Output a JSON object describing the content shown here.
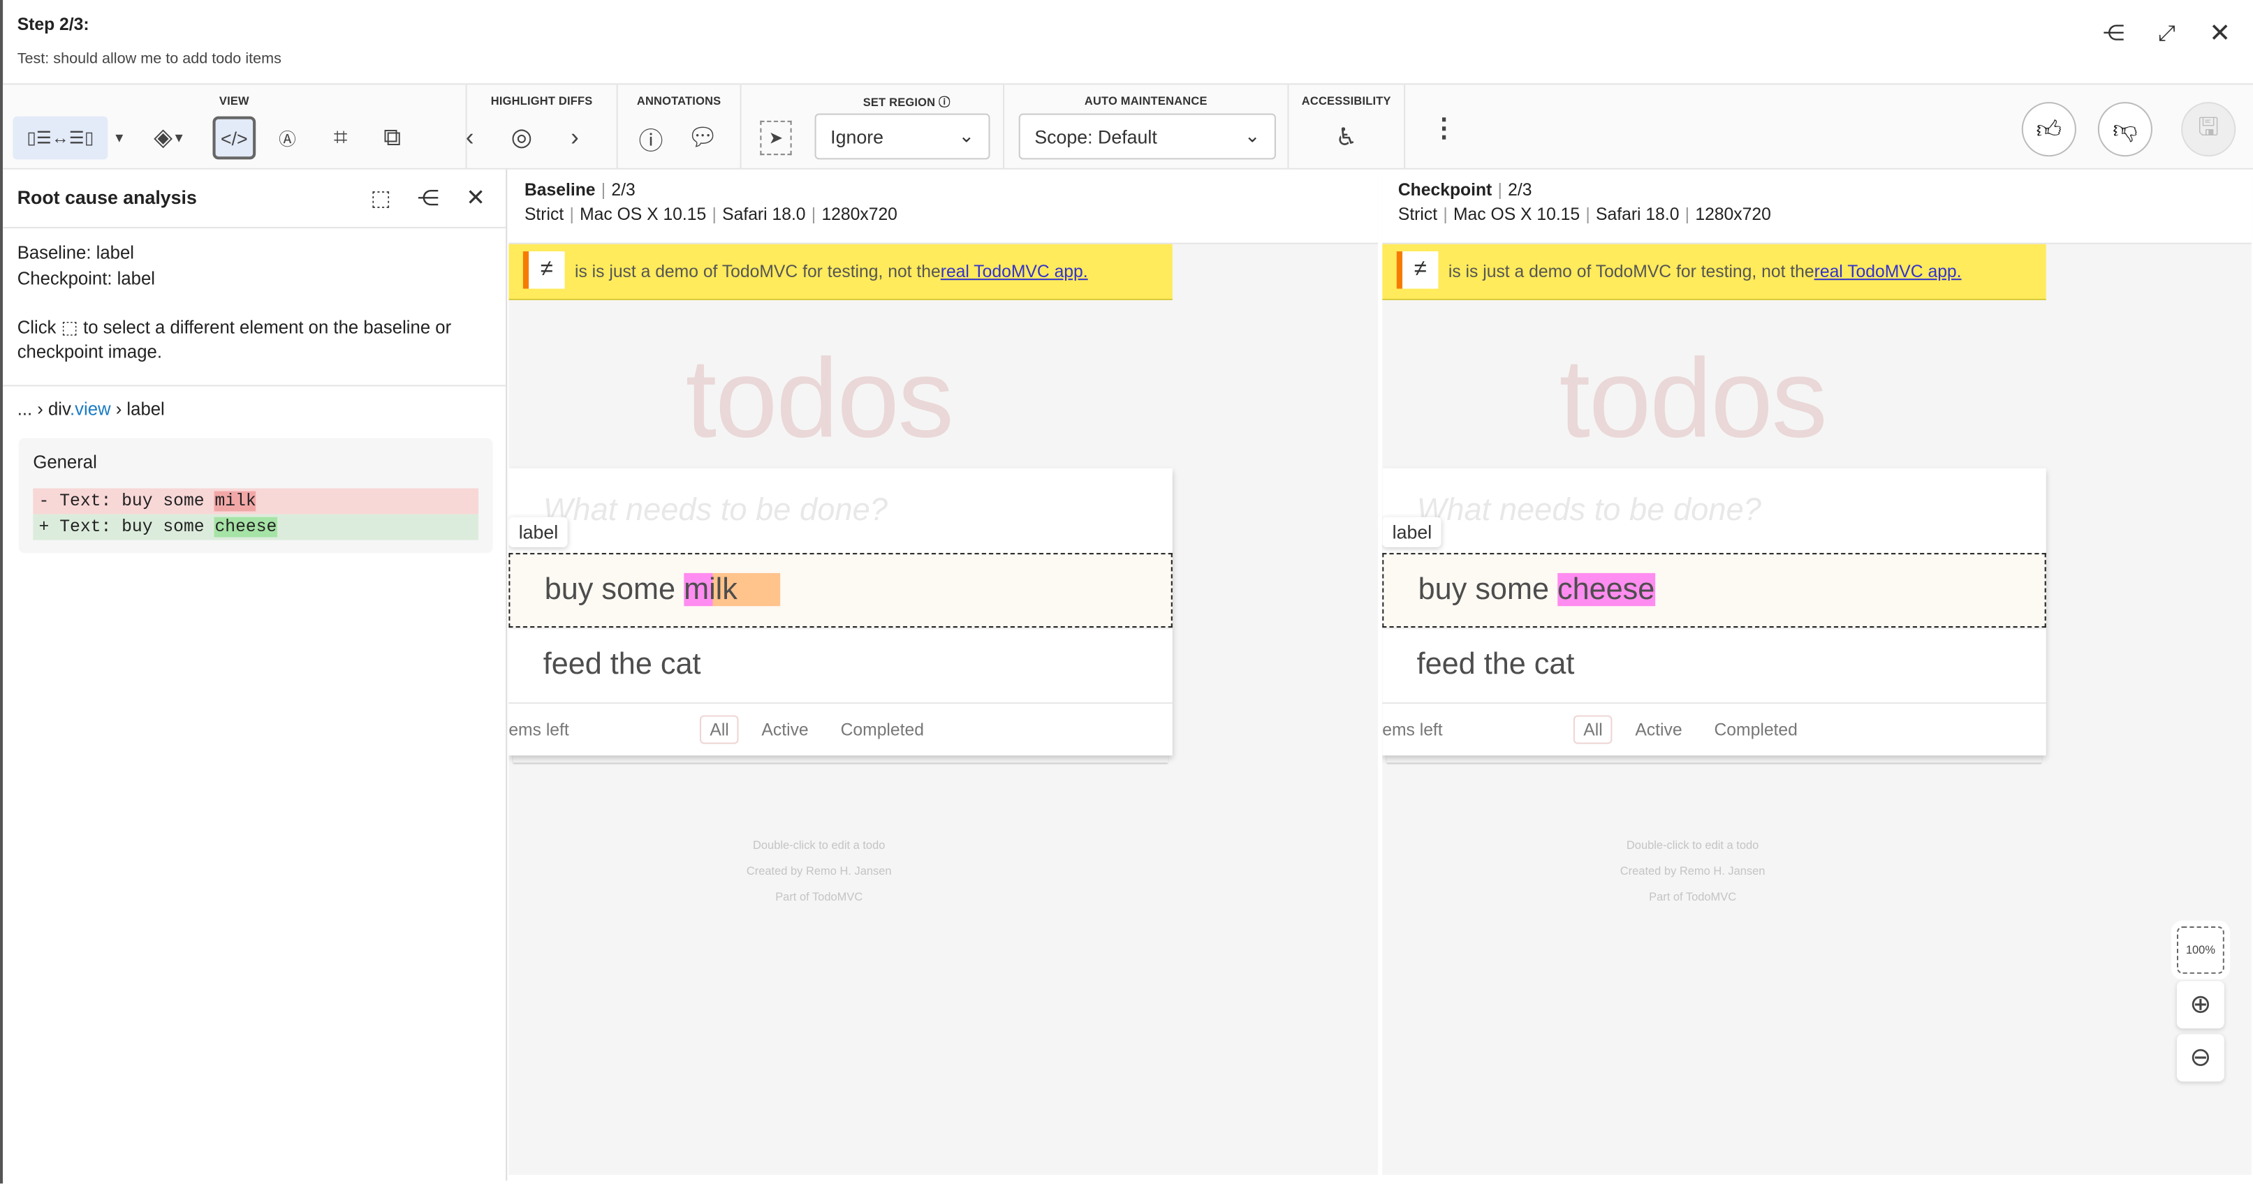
{
  "header": {
    "title": "Step 2/3:",
    "subtitle": "Test: should allow me to add todo items"
  },
  "toolbar": {
    "view_label": "VIEW",
    "highlight_label": "HIGHLIGHT DIFFS",
    "annotations_label": "ANNOTATIONS",
    "set_region_label": "SET REGION",
    "set_region_value": "Ignore",
    "auto_maintenance_label": "AUTO MAINTENANCE",
    "auto_maintenance_value": "Scope: Default",
    "accessibility_label": "ACCESSIBILITY"
  },
  "rca": {
    "title": "Root cause analysis",
    "baseline": "Baseline: label",
    "checkpoint": "Checkpoint: label",
    "hint_pre": "Click",
    "hint_post": "to select a different element on the baseline or checkpoint image.",
    "crumb_ellipsis": "...",
    "crumb_div": "div",
    "crumb_class": ".view",
    "crumb_label": "label",
    "general": "General",
    "removed": {
      "sign": "-",
      "prefix": "Text: buy some ",
      "changed": "milk"
    },
    "added": {
      "sign": "+",
      "prefix": "Text: buy some ",
      "changed": "cheese"
    },
    "colors": {
      "removed_bg": "#f8d7d7",
      "removed_hl": "#f2a7a7",
      "added_bg": "#dcecdc",
      "added_hl": "#a6e3a6"
    }
  },
  "baseline": {
    "title": "Baseline",
    "step": "2/3",
    "match": "Strict",
    "os": "Mac OS X 10.15",
    "browser": "Safari 18.0",
    "viewport": "1280x720",
    "item1": "buy some milk",
    "item1_pre": "buy some ",
    "item1_diff": "milk"
  },
  "checkpoint": {
    "title": "Checkpoint",
    "step": "2/3",
    "match": "Strict",
    "os": "Mac OS X 10.15",
    "browser": "Safari 18.0",
    "viewport": "1280x720",
    "item1": "buy some cheese",
    "item1_pre": "buy some ",
    "item1_diff": "cheese"
  },
  "app": {
    "banner_text": "is is just a demo of TodoMVC for testing, not the ",
    "banner_link": "real TodoMVC app.",
    "heading": "todos",
    "placeholder": "What needs to be done?",
    "tag": "label",
    "item2": "feed the cat",
    "items_left": "ems left",
    "filters": [
      "All",
      "Active",
      "Completed"
    ],
    "footer1": "Double-click to edit a todo",
    "footer2": "Created by Remo H. Jansen",
    "footer3": "Part of TodoMVC",
    "neq_symbol": "≠"
  },
  "zoom": {
    "fit_label": "100%"
  }
}
